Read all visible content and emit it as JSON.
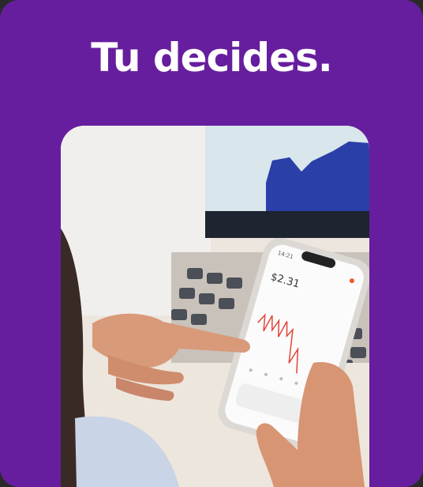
{
  "card": {
    "headline": "Tu decides.",
    "background_color": "#661e9e"
  },
  "photo": {
    "phone_screen": {
      "status_time": "14:21",
      "price": "$2.31"
    }
  }
}
